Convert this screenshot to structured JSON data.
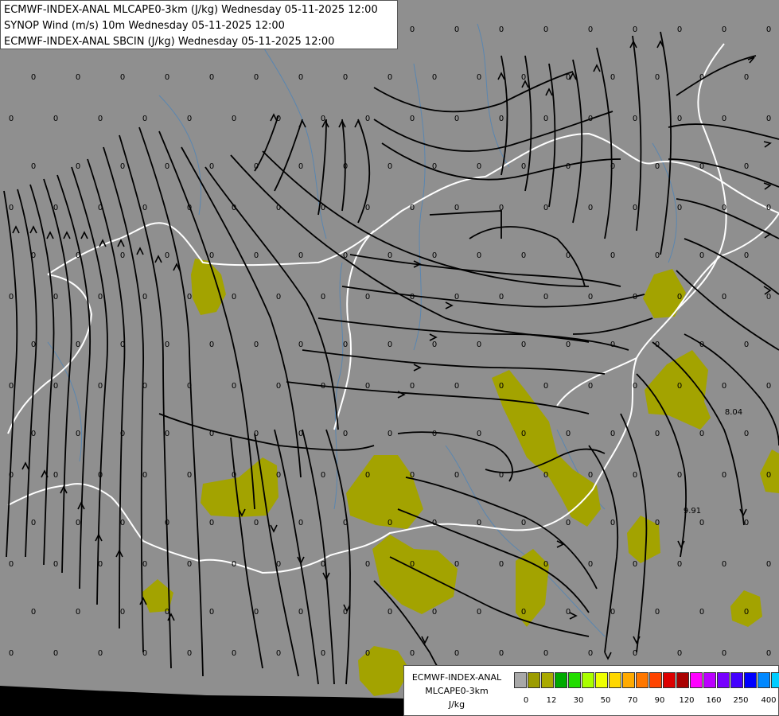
{
  "header": {
    "line1": "ECMWF-INDEX-ANAL MLCAPE0-3km (J/kg) Wednesday 05-11-2025 12:00",
    "line2": "SYNOP Wind (m/s) 10m Wednesday 05-11-2025 12:00",
    "line3": "ECMWF-INDEX-ANAL SBCIN (J/kg) Wednesday 05-11-2025 12:00"
  },
  "legend": {
    "title1": "ECMWF-INDEX-ANAL",
    "title2": "MLCAPE0-3km",
    "unit": "J/kg",
    "tick_labels": [
      "0",
      "12",
      "30",
      "50",
      "70",
      "90",
      "120",
      "160",
      "250",
      "400"
    ],
    "colors": [
      "#a8a8a8",
      "#9c9c00",
      "#aaaa00",
      "#00aa00",
      "#22dd00",
      "#aaff00",
      "#eeff00",
      "#ffd700",
      "#ffaa00",
      "#ff7700",
      "#ff4400",
      "#dd0000",
      "#aa0000",
      "#ff00ff",
      "#bb00ff",
      "#7700ff",
      "#4400ff",
      "#0000ff",
      "#0088ff",
      "#00ccff",
      "#66ffff",
      "#ffffff"
    ]
  },
  "cin_values": [
    "8.04",
    "9.91"
  ],
  "zero_label": "0",
  "map_colors": {
    "background": "#8f8f8f",
    "cape_fill": "#a3a300",
    "borders": "#ffffff",
    "rivers": "#5a86b0",
    "streamlines": "#000000",
    "outside": "#000000"
  }
}
